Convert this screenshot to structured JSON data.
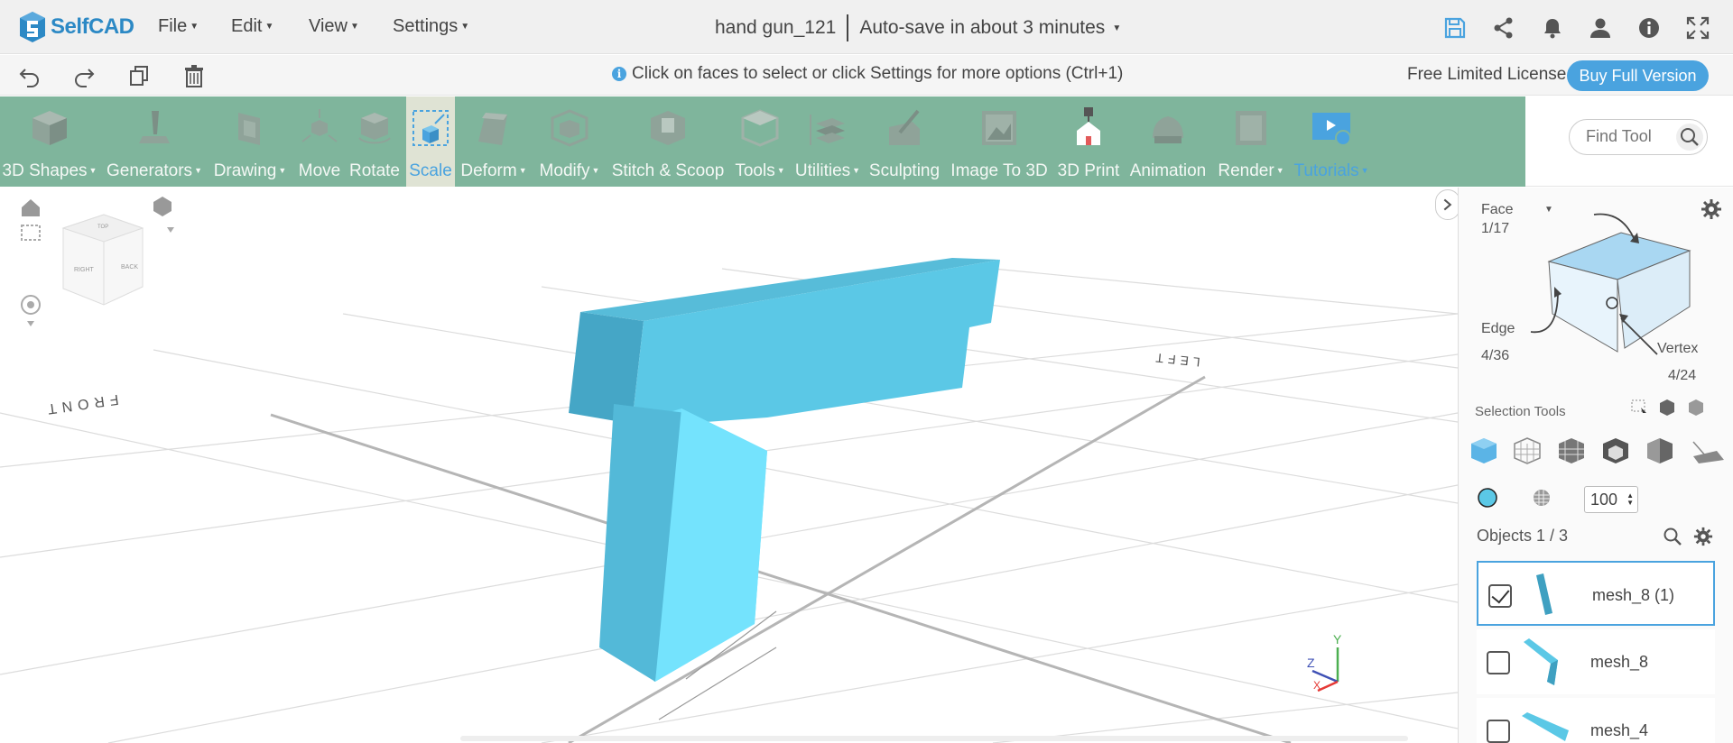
{
  "app": {
    "logo_text": "SelfCAD",
    "brand_color": "#2c89c5",
    "accent_color": "#4aa3df",
    "toolbar_color": "#7fb59c"
  },
  "menu": [
    {
      "label": "File"
    },
    {
      "label": "Edit"
    },
    {
      "label": "View"
    },
    {
      "label": "Settings"
    }
  ],
  "project": {
    "name": "hand gun_121",
    "autosave": "Auto-save in about 3 minutes"
  },
  "top_icons": [
    "save-icon",
    "share-icon",
    "bell-icon",
    "user-icon",
    "info-icon",
    "fullscreen-icon"
  ],
  "edit_icons": [
    "undo-icon",
    "redo-icon",
    "copy-icon",
    "trash-icon"
  ],
  "hint": "Click on faces to select or click Settings for more options (Ctrl+1)",
  "license": {
    "text": "Free Limited License",
    "button": "Buy Full Version"
  },
  "toolbar": {
    "tools": [
      {
        "label": "3D Shapes",
        "dropdown": true
      },
      {
        "label": "Generators",
        "dropdown": true
      },
      {
        "label": "Drawing",
        "dropdown": true
      },
      {
        "label": "Move",
        "dropdown": false
      },
      {
        "label": "Rotate",
        "dropdown": false
      },
      {
        "label": "Scale",
        "dropdown": false,
        "active": true
      },
      {
        "label": "Deform",
        "dropdown": true
      },
      {
        "label": "Modify",
        "dropdown": true
      },
      {
        "label": "Stitch & Scoop",
        "dropdown": false
      },
      {
        "label": "Tools",
        "dropdown": true
      },
      {
        "label": "Utilities",
        "dropdown": true
      },
      {
        "label": "Sculpting",
        "dropdown": false
      },
      {
        "label": "Image To 3D",
        "dropdown": false
      },
      {
        "label": "3D Print",
        "dropdown": false
      },
      {
        "label": "Animation",
        "dropdown": false
      },
      {
        "label": "Render",
        "dropdown": true
      },
      {
        "label": "Tutorials",
        "dropdown": true
      }
    ],
    "find_tool_placeholder": "Find Tool"
  },
  "viewport": {
    "cube_labels": {
      "right": "RIGHT",
      "back": "BACK",
      "top": "TOP"
    },
    "floor_labels": {
      "front": "FRONT",
      "left": "LEFT"
    },
    "axis": {
      "y": "Y",
      "z": "Z",
      "x": "X"
    },
    "model_color": "#5bc8e6"
  },
  "panel": {
    "mode": {
      "label": "Face",
      "count": "1/17"
    },
    "edge": {
      "label": "Edge",
      "count": "4/36"
    },
    "vertex": {
      "label": "Vertex",
      "count": "4/24"
    },
    "selection_tools_label": "Selection Tools",
    "opacity_value": "100",
    "objects_title": "Objects 1 / 3",
    "objects": [
      {
        "name": "mesh_8 (1)",
        "checked": true
      },
      {
        "name": "mesh_8",
        "checked": false
      },
      {
        "name": "mesh_4",
        "checked": false
      }
    ]
  }
}
